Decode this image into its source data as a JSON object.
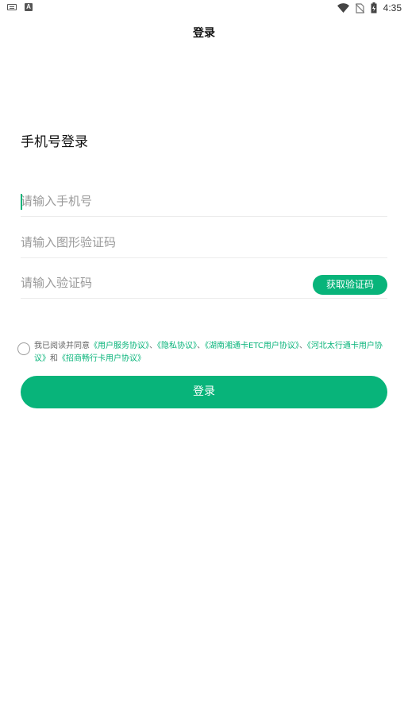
{
  "status_bar": {
    "time": "4:35",
    "left_icons": [
      "keyboard-icon",
      "a-icon"
    ],
    "right_icons": [
      "wifi-icon",
      "no-sim-icon",
      "battery-icon"
    ]
  },
  "header": {
    "title": "登录"
  },
  "page": {
    "heading": "手机号登录"
  },
  "form": {
    "phone_placeholder": "请输入手机号",
    "phone_value": "",
    "captcha_placeholder": "请输入图形验证码",
    "captcha_value": "",
    "code_placeholder": "请输入验证码",
    "code_value": "",
    "get_code_label": "获取验证码"
  },
  "agreement": {
    "checked": false,
    "prefix": "我已阅读并同意",
    "link1": "《用户服务协议》",
    "sep1": "、",
    "link2": "《隐私协议》",
    "sep2": "、",
    "link3": "《湖南湘通卡ETC用户协议》",
    "sep3": "、",
    "link4": "《河北太行通卡用户协议》",
    "conj": "和",
    "link5": "《招商畅行卡用户协议》"
  },
  "login_button": {
    "label": "登录"
  },
  "colors": {
    "accent": "#08b47a",
    "text": "#111111",
    "placeholder": "#999999"
  }
}
